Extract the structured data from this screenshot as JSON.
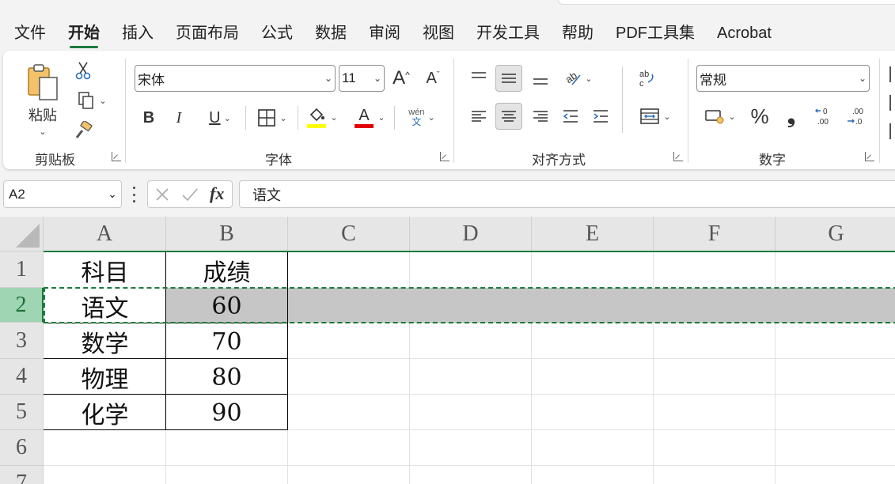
{
  "menu": {
    "tabs": [
      {
        "label": "文件"
      },
      {
        "label": "开始",
        "active": true
      },
      {
        "label": "插入"
      },
      {
        "label": "页面布局"
      },
      {
        "label": "公式"
      },
      {
        "label": "数据"
      },
      {
        "label": "审阅"
      },
      {
        "label": "视图"
      },
      {
        "label": "开发工具"
      },
      {
        "label": "帮助"
      },
      {
        "label": "PDF工具集"
      },
      {
        "label": "Acrobat"
      }
    ]
  },
  "ribbon": {
    "clipboard": {
      "label": "剪贴板",
      "paste_label": "粘贴"
    },
    "font": {
      "label": "字体",
      "font_name": "宋体",
      "font_size": "11",
      "bold": "B",
      "italic": "I",
      "underline": "U",
      "phonetic_top": "wén",
      "phonetic_bottom": "文",
      "grow": "A",
      "shrink": "A",
      "fill_color": "#ffff00",
      "font_color": "#e00000",
      "font_color_letter": "A"
    },
    "alignment": {
      "label": "对齐方式"
    },
    "number": {
      "label": "数字",
      "format": "常规",
      "percent": "%",
      "comma": "❟"
    }
  },
  "formula_bar": {
    "name_box": "A2",
    "fx": "fx",
    "value": "语文"
  },
  "sheet": {
    "columns": [
      "A",
      "B",
      "C",
      "D",
      "E",
      "F",
      "G"
    ],
    "rows": [
      "1",
      "2",
      "3",
      "4",
      "5",
      "6",
      "7"
    ],
    "cells": [
      [
        "科目",
        "成绩"
      ],
      [
        "语文",
        "60"
      ],
      [
        "数学",
        "70"
      ],
      [
        "物理",
        "80"
      ],
      [
        "化学",
        "90"
      ]
    ],
    "selected_row": "2",
    "accent": "#1b7a3e"
  }
}
